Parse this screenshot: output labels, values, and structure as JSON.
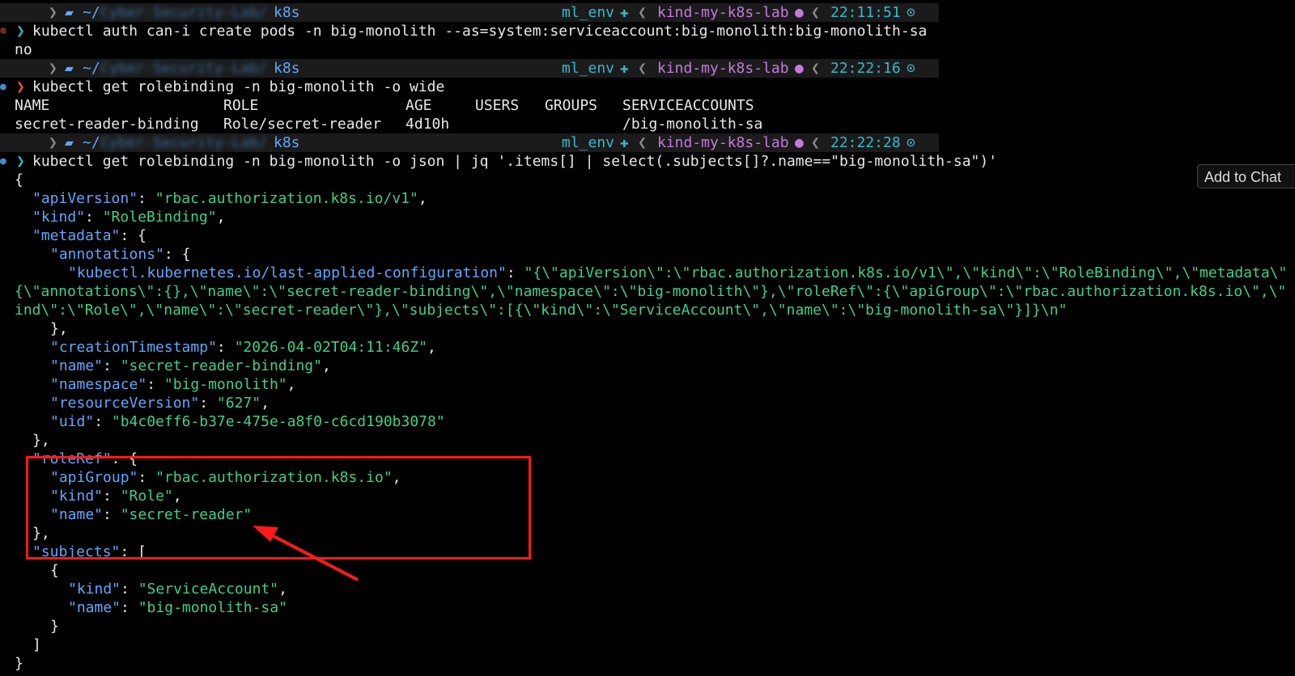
{
  "prompts": [
    {
      "path": "~/",
      "hidden_path": "Cyber-Security-Lab/",
      "dir": "k8s",
      "env": "ml_env",
      "context": "kind-my-k8s-lab",
      "time": "22:11:51"
    },
    {
      "path": "~/",
      "hidden_path": "Cyber-Security-Lab/",
      "dir": "k8s",
      "env": "ml_env",
      "context": "kind-my-k8s-lab",
      "time": "22:22:16"
    },
    {
      "path": "~/",
      "hidden_path": "Cyber-Security-Lab/",
      "dir": "k8s",
      "env": "ml_env",
      "context": "kind-my-k8s-lab",
      "time": "22:22:28"
    }
  ],
  "commands": {
    "c1": "kubectl auth can-i create pods -n big-monolith --as=system:serviceaccount:big-monolith:big-monolith-sa",
    "c1_output": "no",
    "c2": "kubectl get rolebinding -n big-monolith -o wide",
    "c3": "kubectl get rolebinding -n big-monolith -o json | jq '.items[] | select(.subjects[]?.name==\"big-monolith-sa\")'"
  },
  "table": {
    "headers": [
      "NAME",
      "ROLE",
      "AGE",
      "USERS",
      "GROUPS",
      "SERVICEACCOUNTS"
    ],
    "row": [
      "secret-reader-binding",
      "Role/secret-reader",
      "4d10h",
      "",
      "",
      "/big-monolith-sa"
    ]
  },
  "json": {
    "apiVersion_key": "\"apiVersion\"",
    "apiVersion_val": "\"rbac.authorization.k8s.io/v1\"",
    "kind_key": "\"kind\"",
    "kind_val": "\"RoleBinding\"",
    "metadata_key": "\"metadata\"",
    "annotations_key": "\"annotations\"",
    "lac_key": "\"kubectl.kubernetes.io/last-applied-configuration\"",
    "lac_val_1": "\"{\\\"apiVersion\\\":\\\"rbac.authorization.k8s.io/v1\\\",\\\"kind\\\":\\\"RoleBinding\\\",\\\"metadata\\\"",
    "lac_val_2": "{\\\"annotations\\\":{},\\\"name\\\":\\\"secret-reader-binding\\\",\\\"namespace\\\":\\\"big-monolith\\\"},\\\"roleRef\\\":{\\\"apiGroup\\\":\\\"rbac.authorization.k8s.io\\\",\\\"",
    "lac_val_3": "ind\\\":\\\"Role\\\",\\\"name\\\":\\\"secret-reader\\\"},\\\"subjects\\\":[{\\\"kind\\\":\\\"ServiceAccount\\\",\\\"name\\\":\\\"big-monolith-sa\\\"}]}\\n\"",
    "ct_key": "\"creationTimestamp\"",
    "ct_val": "\"2026-04-02T04:11:46Z\"",
    "name_key": "\"name\"",
    "name_val": "\"secret-reader-binding\"",
    "ns_key": "\"namespace\"",
    "ns_val": "\"big-monolith\"",
    "rv_key": "\"resourceVersion\"",
    "rv_val": "\"627\"",
    "uid_key": "\"uid\"",
    "uid_val": "\"b4c0eff6-b37e-475e-a8f0-c6cd190b3078\"",
    "roleRef_key": "\"roleRef\"",
    "rr_apiGroup_key": "\"apiGroup\"",
    "rr_apiGroup_val": "\"rbac.authorization.k8s.io\"",
    "rr_kind_key": "\"kind\"",
    "rr_kind_val": "\"Role\"",
    "rr_name_key": "\"name\"",
    "rr_name_val": "\"secret-reader\"",
    "subjects_key": "\"subjects\"",
    "sub_kind_key": "\"kind\"",
    "sub_kind_val": "\"ServiceAccount\"",
    "sub_name_key": "\"name\"",
    "sub_name_val": "\"big-monolith-sa\""
  },
  "add_to_chat": "Add to Chat",
  "annotation_color": "#ff1a1a",
  "icons": [
    "apple-icon",
    "folder-icon",
    "env-icon",
    "k8s-icon",
    "clock-icon",
    "prompt-chevron-icon"
  ]
}
